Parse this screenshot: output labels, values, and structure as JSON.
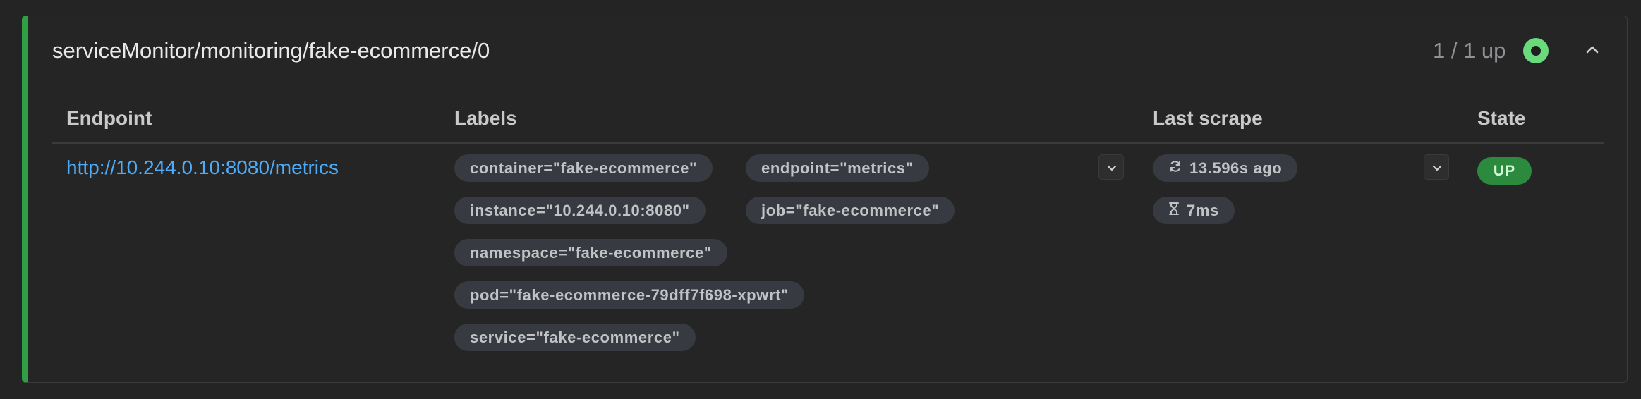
{
  "pool": {
    "title": "serviceMonitor/monitoring/fake-ecommerce/0",
    "count": "1 / 1 up"
  },
  "table": {
    "headers": {
      "endpoint": "Endpoint",
      "labels": "Labels",
      "last_scrape": "Last scrape",
      "state": "State"
    },
    "row": {
      "endpoint": "http://10.244.0.10:8080/metrics",
      "labels": [
        "container=\"fake-ecommerce\"",
        "endpoint=\"metrics\"",
        "instance=\"10.244.0.10:8080\"",
        "job=\"fake-ecommerce\"",
        "namespace=\"fake-ecommerce\"",
        "pod=\"fake-ecommerce-79dff7f698-xpwrt\"",
        "service=\"fake-ecommerce\""
      ],
      "last_scrape": "13.596s ago",
      "scrape_duration": "7ms",
      "state": "UP"
    }
  },
  "colors": {
    "health_ok": "#69db7c",
    "up_badge": "#2b8a3e",
    "link": "#4dabf7",
    "accent_border": "#2f9e44"
  },
  "icons": {
    "health": "health-dot-icon",
    "collapse": "chevron-up-icon",
    "expand": "chevron-down-icon",
    "refresh": "refresh-icon",
    "duration": "hourglass-icon"
  }
}
